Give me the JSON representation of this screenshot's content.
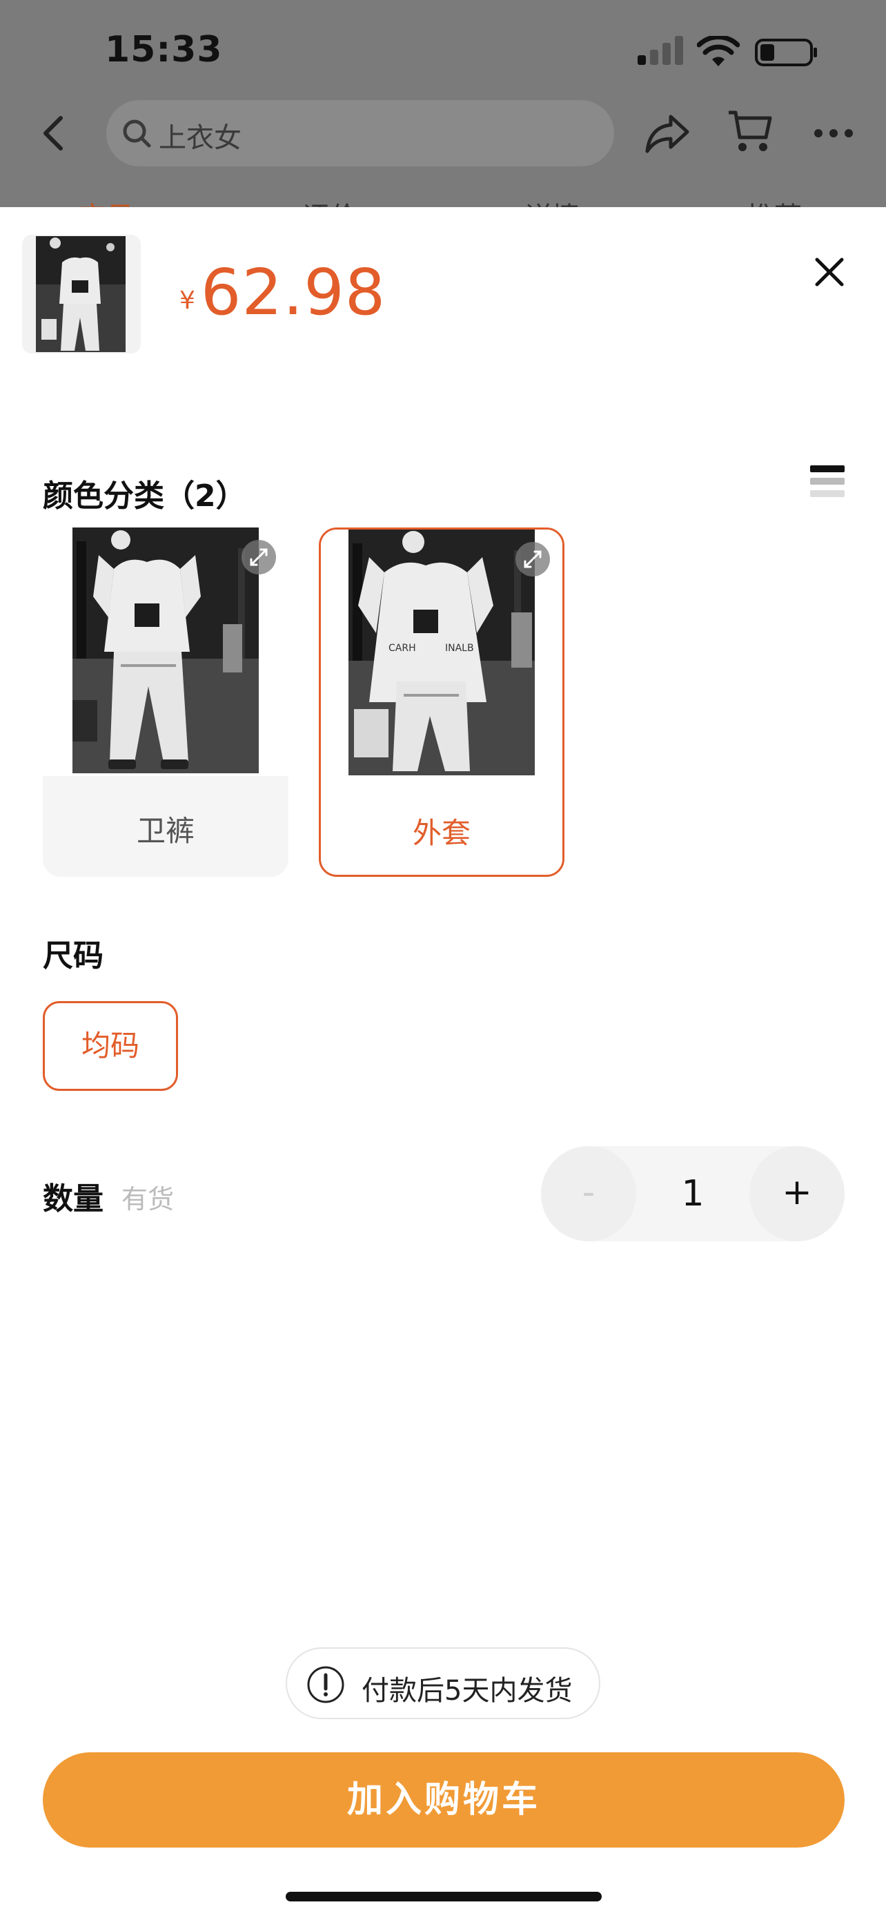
{
  "status_bar": {
    "time": "15:33"
  },
  "nav": {
    "search_placeholder": "上衣女"
  },
  "tabs_peek": [
    "宝贝",
    "评价",
    "详情",
    "推荐"
  ],
  "product": {
    "currency_symbol": "¥",
    "price": "62.98"
  },
  "color_section": {
    "title": "颜色分类（2）",
    "options": [
      {
        "label": "卫裤",
        "selected": false
      },
      {
        "label": "外套",
        "selected": true
      }
    ]
  },
  "size_section": {
    "title": "尺码",
    "options": [
      {
        "label": "均码",
        "selected": true
      }
    ]
  },
  "quantity": {
    "title": "数量",
    "stock": "有货",
    "minus": "-",
    "value": "1",
    "plus": "+"
  },
  "notice": {
    "text": "付款后5天内发货"
  },
  "add_to_cart": {
    "label": "加入购物车"
  },
  "colors": {
    "accent": "#e25d2a",
    "button": "#f19b36"
  }
}
